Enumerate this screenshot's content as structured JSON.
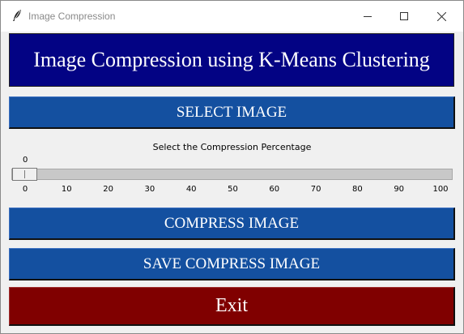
{
  "window": {
    "title": "Image Compression",
    "icon": "feather-icon"
  },
  "header": {
    "title": "Image Compression using K-Means Clustering"
  },
  "buttons": {
    "select": "SELECT IMAGE",
    "compress": "COMPRESS IMAGE",
    "save": "SAVE COMPRESS IMAGE",
    "exit": "Exit"
  },
  "slider": {
    "label": "Select the Compression Percentage",
    "value": 0,
    "min": 0,
    "max": 100,
    "ticks": [
      "0",
      "10",
      "20",
      "30",
      "40",
      "50",
      "60",
      "70",
      "80",
      "90",
      "100"
    ]
  },
  "colors": {
    "header_bg": "#030384",
    "button_blue": "#1450a0",
    "exit_red": "#800000"
  }
}
